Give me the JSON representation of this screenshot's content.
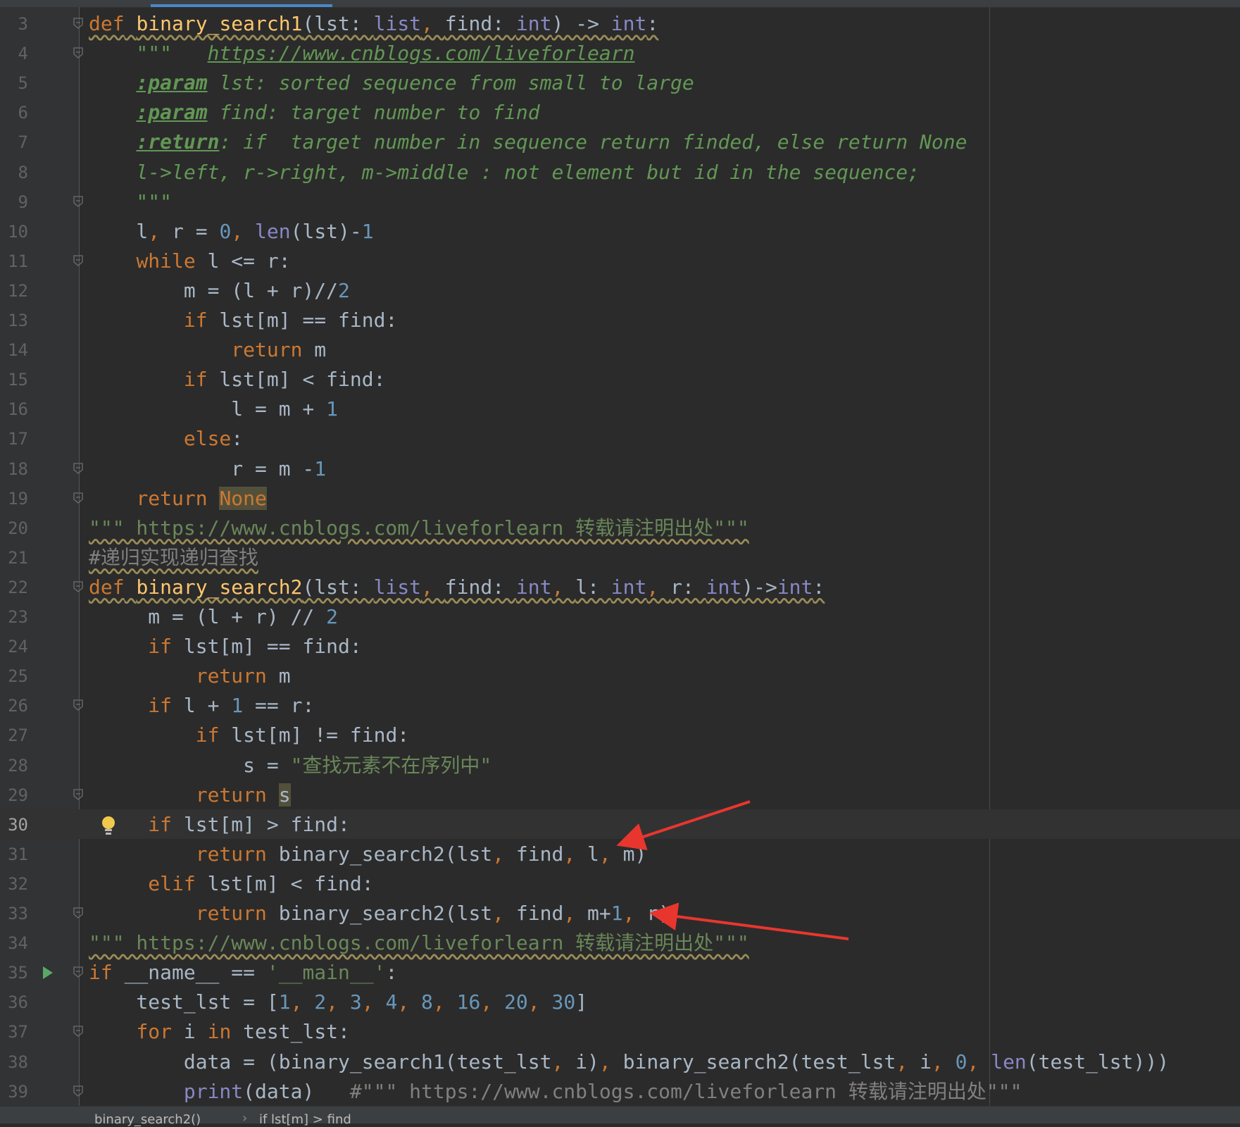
{
  "editor": {
    "current_line": 30,
    "lines": [
      {
        "n": "3",
        "tokens": [
          [
            "def",
            "kw"
          ],
          [
            " ",
            ""
          ],
          [
            "binary_search1",
            "fn"
          ],
          [
            "(lst: ",
            ""
          ],
          [
            "list",
            "bi"
          ],
          [
            ", ",
            "kw"
          ],
          [
            "find: ",
            ""
          ],
          [
            "int",
            "bi"
          ],
          [
            ") -> ",
            ""
          ],
          [
            "int",
            "bi"
          ],
          [
            ":",
            ""
          ]
        ],
        "squiggle": true
      },
      {
        "n": "4",
        "tokens": [
          [
            "    \"\"\"   ",
            "doc"
          ],
          [
            "https://www.cnblogs.com/liveforlearn",
            "link"
          ]
        ]
      },
      {
        "n": "5",
        "tokens": [
          [
            "    ",
            ""
          ],
          [
            ":param",
            "doctag"
          ],
          [
            " lst: sorted sequence from small to large",
            "doc"
          ]
        ]
      },
      {
        "n": "6",
        "tokens": [
          [
            "    ",
            ""
          ],
          [
            ":param",
            "doctag"
          ],
          [
            " find: target number to find",
            "doc"
          ]
        ]
      },
      {
        "n": "7",
        "tokens": [
          [
            "    ",
            ""
          ],
          [
            ":return",
            "doctag"
          ],
          [
            ": if  target number in sequence return finded, else return None",
            "doc"
          ]
        ]
      },
      {
        "n": "8",
        "tokens": [
          [
            "    l->left, r->right, m->middle : not element but id in the sequence;",
            "doc"
          ]
        ]
      },
      {
        "n": "9",
        "tokens": [
          [
            "    \"\"\"",
            "doc"
          ]
        ]
      },
      {
        "n": "10",
        "tokens": [
          [
            "    l",
            ""
          ],
          [
            ", ",
            "kw"
          ],
          [
            "r = ",
            ""
          ],
          [
            "0",
            "num"
          ],
          [
            ", ",
            "kw"
          ],
          [
            "len",
            "bi"
          ],
          [
            "(lst)-",
            ""
          ],
          [
            "1",
            "num"
          ]
        ]
      },
      {
        "n": "11",
        "tokens": [
          [
            "    ",
            ""
          ],
          [
            "while",
            "kw"
          ],
          [
            " l <= r:",
            ""
          ]
        ]
      },
      {
        "n": "12",
        "tokens": [
          [
            "        m = (l + r)//",
            ""
          ],
          [
            "2",
            "num"
          ]
        ]
      },
      {
        "n": "13",
        "tokens": [
          [
            "        ",
            ""
          ],
          [
            "if",
            "kw"
          ],
          [
            " lst[m] == find:",
            ""
          ]
        ]
      },
      {
        "n": "14",
        "tokens": [
          [
            "            ",
            ""
          ],
          [
            "return",
            "kw"
          ],
          [
            " m",
            ""
          ]
        ]
      },
      {
        "n": "15",
        "tokens": [
          [
            "        ",
            ""
          ],
          [
            "if",
            "kw"
          ],
          [
            " lst[m] < find:",
            ""
          ]
        ]
      },
      {
        "n": "16",
        "tokens": [
          [
            "            l = m + ",
            ""
          ],
          [
            "1",
            "num"
          ]
        ]
      },
      {
        "n": "17",
        "tokens": [
          [
            "        ",
            ""
          ],
          [
            "else",
            "kw"
          ],
          [
            ":",
            ""
          ]
        ]
      },
      {
        "n": "18",
        "tokens": [
          [
            "            r = m -",
            ""
          ],
          [
            "1",
            "num"
          ]
        ]
      },
      {
        "n": "19",
        "tokens": [
          [
            "    ",
            ""
          ],
          [
            "return",
            "kw"
          ],
          [
            " ",
            ""
          ],
          [
            "None",
            "kw hl"
          ]
        ]
      },
      {
        "n": "20",
        "tokens": [
          [
            "\"\"\" https://www.cnblogs.com/liveforlearn 转载请注明出处\"\"\"",
            "str"
          ]
        ],
        "squiggle": true
      },
      {
        "n": "21",
        "tokens": [
          [
            "#递归实现递归查找",
            "cm"
          ]
        ],
        "squiggle": true
      },
      {
        "n": "22",
        "tokens": [
          [
            "def",
            "kw"
          ],
          [
            " ",
            ""
          ],
          [
            "binary_search2",
            "fn"
          ],
          [
            "(lst: ",
            ""
          ],
          [
            "list",
            "bi"
          ],
          [
            ", ",
            "kw"
          ],
          [
            "find: ",
            ""
          ],
          [
            "int",
            "bi"
          ],
          [
            ", ",
            "kw"
          ],
          [
            "l: ",
            ""
          ],
          [
            "int",
            "bi"
          ],
          [
            ", ",
            "kw"
          ],
          [
            "r: ",
            ""
          ],
          [
            "int",
            "bi"
          ],
          [
            ")->",
            ""
          ],
          [
            "int",
            "bi"
          ],
          [
            ":",
            ""
          ]
        ],
        "squiggle": true
      },
      {
        "n": "23",
        "tokens": [
          [
            "     m = (l + r) // ",
            ""
          ],
          [
            "2",
            "num"
          ]
        ]
      },
      {
        "n": "24",
        "tokens": [
          [
            "     ",
            ""
          ],
          [
            "if",
            "kw"
          ],
          [
            " lst[m] == find:",
            ""
          ]
        ]
      },
      {
        "n": "25",
        "tokens": [
          [
            "         ",
            ""
          ],
          [
            "return",
            "kw"
          ],
          [
            " m",
            ""
          ]
        ]
      },
      {
        "n": "26",
        "tokens": [
          [
            "     ",
            ""
          ],
          [
            "if",
            "kw"
          ],
          [
            " l + ",
            ""
          ],
          [
            "1",
            "num"
          ],
          [
            " == r:",
            ""
          ]
        ]
      },
      {
        "n": "27",
        "tokens": [
          [
            "         ",
            ""
          ],
          [
            "if",
            "kw"
          ],
          [
            " lst[m] != find:",
            ""
          ]
        ]
      },
      {
        "n": "28",
        "tokens": [
          [
            "             s = ",
            ""
          ],
          [
            "\"查找元素不在序列中\"",
            "str"
          ]
        ]
      },
      {
        "n": "29",
        "tokens": [
          [
            "         ",
            ""
          ],
          [
            "return",
            "kw"
          ],
          [
            " ",
            ""
          ],
          [
            "s",
            "hl"
          ]
        ]
      },
      {
        "n": "30",
        "tokens": [
          [
            "     ",
            ""
          ],
          [
            "if",
            "kw"
          ],
          [
            " lst[m] > find:",
            ""
          ]
        ]
      },
      {
        "n": "31",
        "tokens": [
          [
            "         ",
            ""
          ],
          [
            "return",
            "kw"
          ],
          [
            " binary_search2(lst",
            ""
          ],
          [
            ", ",
            "kw"
          ],
          [
            "find",
            ""
          ],
          [
            ", ",
            "kw"
          ],
          [
            "l",
            ""
          ],
          [
            ", ",
            "kw"
          ],
          [
            "m)",
            ""
          ]
        ]
      },
      {
        "n": "32",
        "tokens": [
          [
            "     ",
            ""
          ],
          [
            "elif",
            "kw"
          ],
          [
            " lst[m] < find:",
            ""
          ]
        ]
      },
      {
        "n": "33",
        "tokens": [
          [
            "         ",
            ""
          ],
          [
            "return",
            "kw"
          ],
          [
            " binary_search2(lst",
            ""
          ],
          [
            ", ",
            "kw"
          ],
          [
            "find",
            ""
          ],
          [
            ", ",
            "kw"
          ],
          [
            "m+",
            ""
          ],
          [
            "1",
            "num"
          ],
          [
            ", ",
            "kw"
          ],
          [
            "r)",
            ""
          ]
        ]
      },
      {
        "n": "34",
        "tokens": [
          [
            "\"\"\" https://www.cnblogs.com/liveforlearn 转载请注明出处\"\"\"",
            "str"
          ]
        ],
        "squiggle": true
      },
      {
        "n": "35",
        "tokens": [
          [
            "if",
            "kw"
          ],
          [
            " __name__ == ",
            ""
          ],
          [
            "'__main__'",
            "str"
          ],
          [
            ":",
            ""
          ]
        ]
      },
      {
        "n": "36",
        "tokens": [
          [
            "    test_lst = [",
            ""
          ],
          [
            "1",
            "num"
          ],
          [
            ", ",
            "kw"
          ],
          [
            "2",
            "num"
          ],
          [
            ", ",
            "kw"
          ],
          [
            "3",
            "num"
          ],
          [
            ", ",
            "kw"
          ],
          [
            "4",
            "num"
          ],
          [
            ", ",
            "kw"
          ],
          [
            "8",
            "num"
          ],
          [
            ", ",
            "kw"
          ],
          [
            "16",
            "num"
          ],
          [
            ", ",
            "kw"
          ],
          [
            "20",
            "num"
          ],
          [
            ", ",
            "kw"
          ],
          [
            "30",
            "num"
          ],
          [
            "]",
            ""
          ]
        ]
      },
      {
        "n": "37",
        "tokens": [
          [
            "    ",
            ""
          ],
          [
            "for",
            "kw"
          ],
          [
            " i ",
            ""
          ],
          [
            "in",
            "kw"
          ],
          [
            " test_lst:",
            ""
          ]
        ]
      },
      {
        "n": "38",
        "tokens": [
          [
            "        data = (binary_search1(test_lst",
            ""
          ],
          [
            ", ",
            "kw"
          ],
          [
            "i)",
            ""
          ],
          [
            ", ",
            "kw"
          ],
          [
            "binary_search2(test_lst",
            ""
          ],
          [
            ", ",
            "kw"
          ],
          [
            "i",
            ""
          ],
          [
            ", ",
            "kw"
          ],
          [
            "0",
            "num"
          ],
          [
            ", ",
            "kw"
          ],
          [
            "len",
            "bi"
          ],
          [
            "(test_lst)))",
            ""
          ]
        ]
      },
      {
        "n": "39",
        "tokens": [
          [
            "        ",
            ""
          ],
          [
            "print",
            "bi"
          ],
          [
            "(data)   ",
            ""
          ],
          [
            "#\"\"\" https://www.cnblogs.com/liveforlearn 转载请注明出处\"\"\"",
            "cm"
          ]
        ]
      }
    ]
  },
  "breadcrumb": {
    "items": [
      "binary_search2()",
      "if lst[m] > find"
    ]
  },
  "colors": {
    "background": "#2b2b2b",
    "keyword": "#cc7832",
    "function": "#ffc66d",
    "number": "#6897bb",
    "string": "#6a8759",
    "docstring": "#629755",
    "builtin": "#8888c6",
    "comment": "#808080",
    "annotation_arrow": "#e8362f"
  }
}
